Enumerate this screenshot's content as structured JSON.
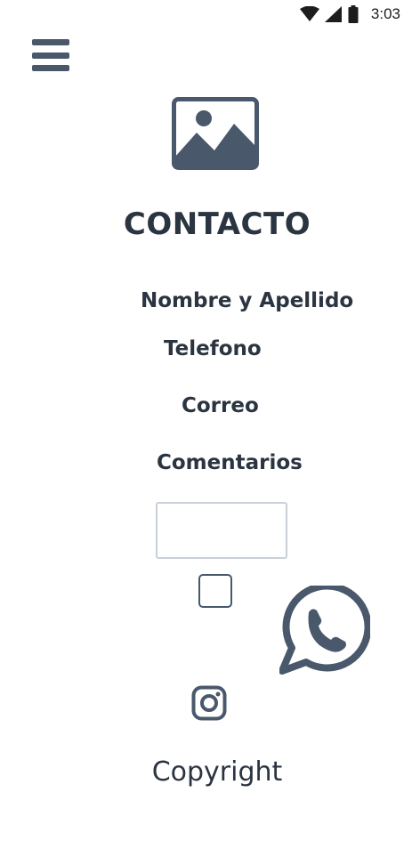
{
  "status_bar": {
    "time": "3:03",
    "icons": [
      "wifi-icon",
      "signal-icon",
      "battery-icon"
    ]
  },
  "header": {
    "menu_icon": "hamburger-menu-icon",
    "image_icon": "image-placeholder-icon"
  },
  "page": {
    "title": "CONTACTO"
  },
  "form": {
    "fields": [
      {
        "label": "Nombre y Apellido"
      },
      {
        "label": "Telefono"
      },
      {
        "label": "Correo"
      },
      {
        "label": "Comentarios"
      }
    ],
    "textbox_value": "",
    "checkbox_checked": false
  },
  "social": {
    "whatsapp_icon": "whatsapp-icon",
    "instagram_icon": "instagram-icon"
  },
  "footer": {
    "copyright": "Copyright"
  },
  "colors": {
    "primary": "#49586a",
    "text": "#2b3441",
    "field_border": "#c9d0d8"
  }
}
